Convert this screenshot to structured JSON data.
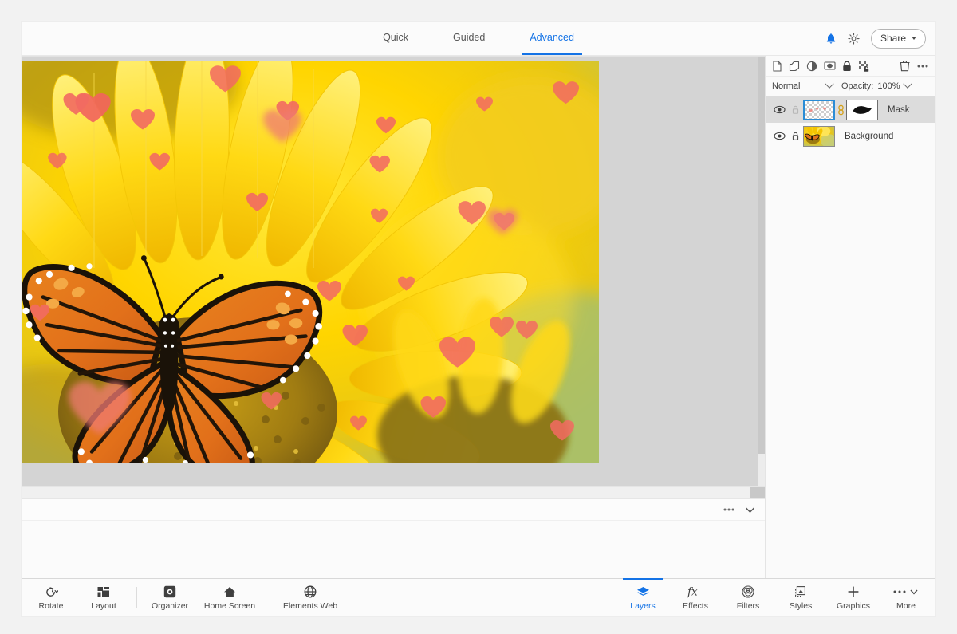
{
  "app": {
    "accent": "#1473e6",
    "canvas_bg": "#d4d4d4"
  },
  "topbar": {
    "modes": [
      {
        "label": "Quick",
        "active": false
      },
      {
        "label": "Guided",
        "active": false
      },
      {
        "label": "Advanced",
        "active": true
      }
    ],
    "notifications_icon": "bell-icon",
    "theme_icon": "brightness-sun-icon",
    "share_label": "Share"
  },
  "layers_panel": {
    "tools": [
      {
        "name": "new-layer-icon",
        "title": "New Layer"
      },
      {
        "name": "duplicate-layer-icon",
        "title": "Duplicate Layer"
      },
      {
        "name": "adjustment-layer-icon",
        "title": "Adjustment Layer"
      },
      {
        "name": "layer-mask-icon",
        "title": "Add Layer Mask"
      },
      {
        "name": "lock-layer-icon",
        "title": "Lock Layer"
      },
      {
        "name": "lock-transparency-icon",
        "title": "Lock Transparent Pixels"
      }
    ],
    "delete_icon": "trash-icon",
    "more_icon": "more-options-icon",
    "blend_mode": "Normal",
    "opacity_label": "Opacity:",
    "opacity_value": "100%",
    "layers": [
      {
        "name": "Mask",
        "selected": true,
        "visible": true,
        "locked": false,
        "thumbnail": "transparent-hearts-thumbnail",
        "has_mask": true,
        "mask_thumbnail": "butterfly-silhouette-mask"
      },
      {
        "name": "Background",
        "selected": false,
        "visible": true,
        "locked": true,
        "thumbnail": "sunflower-butterfly-photo-thumbnail",
        "has_mask": false
      }
    ]
  },
  "canvas": {
    "document": "sunflower-monarch-butterfly-with-hearts",
    "strip_more_icon": "more-options-icon",
    "strip_chevron_icon": "chevron-down-icon"
  },
  "bottombar": {
    "left_items": [
      {
        "label": "Rotate",
        "icon": "rotate-ccw-icon",
        "has_caret": true
      },
      {
        "label": "Layout",
        "icon": "layout-grid-icon",
        "has_caret": false
      },
      {
        "label": "Organizer",
        "icon": "organizer-icon",
        "has_caret": false
      },
      {
        "label": "Home Screen",
        "icon": "home-icon",
        "has_caret": false
      },
      {
        "label": "Elements Web",
        "icon": "globe-icon",
        "has_caret": false
      }
    ],
    "right_items": [
      {
        "label": "Layers",
        "icon": "layers-stack-icon",
        "active": true
      },
      {
        "label": "Effects",
        "icon": "fx-icon",
        "active": false
      },
      {
        "label": "Filters",
        "icon": "filters-circles-icon",
        "active": false
      },
      {
        "label": "Styles",
        "icon": "styles-icon",
        "active": false
      },
      {
        "label": "Graphics",
        "icon": "plus-icon",
        "active": false
      },
      {
        "label": "More",
        "icon": "more-dots-chevron-icon",
        "active": false
      }
    ]
  }
}
